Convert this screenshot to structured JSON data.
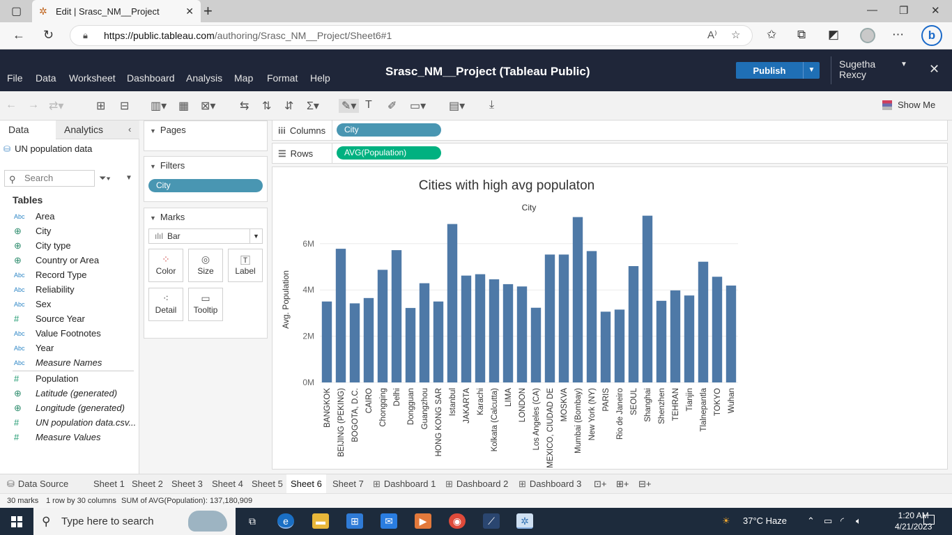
{
  "browser": {
    "tab_title": "Edit | Srasc_NM__Project",
    "url_domain": "https://public.tableau.com",
    "url_path": "/authoring/Srasc_NM__Project/Sheet6#1"
  },
  "header": {
    "menu": [
      "File",
      "Data",
      "Worksheet",
      "Dashboard",
      "Analysis",
      "Map",
      "Format",
      "Help"
    ],
    "title": "Srasc_NM__Project (Tableau Public)",
    "publish_label": "Publish",
    "user_first": "Sugetha",
    "user_last": "Rexcy"
  },
  "toolbar": {
    "show_me_label": "Show Me"
  },
  "datapane": {
    "tab_data": "Data",
    "tab_analytics": "Analytics",
    "datasource": "UN population data",
    "search_placeholder": "Search",
    "tables_label": "Tables",
    "dimensions": [
      {
        "type": "Abc",
        "label": "Area"
      },
      {
        "type": "geo",
        "label": "City"
      },
      {
        "type": "geo",
        "label": "City type"
      },
      {
        "type": "geo",
        "label": "Country or Area"
      },
      {
        "type": "Abc",
        "label": "Record Type"
      },
      {
        "type": "Abc",
        "label": "Reliability"
      },
      {
        "type": "Abc",
        "label": "Sex"
      },
      {
        "type": "#",
        "label": "Source Year"
      },
      {
        "type": "Abc",
        "label": "Value Footnotes"
      },
      {
        "type": "Abc",
        "label": "Year"
      },
      {
        "type": "Abc",
        "label": "Measure Names",
        "italic": true
      }
    ],
    "measures": [
      {
        "type": "#",
        "label": "Population"
      },
      {
        "type": "geo",
        "label": "Latitude (generated)",
        "italic": true
      },
      {
        "type": "geo",
        "label": "Longitude (generated)",
        "italic": true
      },
      {
        "type": "#",
        "label": "UN population data.csv...",
        "italic": true
      },
      {
        "type": "#",
        "label": "Measure Values",
        "italic": true
      }
    ]
  },
  "cards": {
    "pages_label": "Pages",
    "filters_label": "Filters",
    "filter_pill": "City",
    "marks_label": "Marks",
    "mark_type": "Bar",
    "mark_buttons": [
      "Color",
      "Size",
      "Label",
      "Detail",
      "Tooltip"
    ]
  },
  "shelves": {
    "columns_label": "Columns",
    "columns_pill": "City",
    "rows_label": "Rows",
    "rows_pill": "AVG(Population)"
  },
  "chart_data": {
    "type": "bar",
    "title": "Cities with high avg populaton",
    "xlabel": "City",
    "ylabel": "Avg. Population",
    "yticks": [
      "0M",
      "2M",
      "4M",
      "6M"
    ],
    "ylim": [
      0,
      7500000
    ],
    "bar_color": "#4e79a7",
    "categories": [
      "BANGKOK",
      "BEIJING (PEKING)",
      "BOGOTA, D.C.",
      "CAIRO",
      "Chongqing",
      "Delhi",
      "Dongguan",
      "Guangzhou",
      "HONG KONG SAR",
      "Istanbul",
      "JAKARTA",
      "Karachi",
      "Kolkata (Calcutta)",
      "LIMA",
      "LONDON",
      "Los Angeles (CA)",
      "MEXICO, CIUDAD DE",
      "MOSKVA",
      "Mumbai (Bombay)",
      "New York (NY)",
      "PARIS",
      "Rio de Janeiro",
      "SEOUL",
      "Shanghai",
      "Shenzhen",
      "TEHRAN",
      "Tianjin",
      "Tlalnepantla",
      "TOKYO",
      "Wuhan"
    ],
    "values": [
      3500000,
      5780000,
      3420000,
      3650000,
      4870000,
      5720000,
      3220000,
      4290000,
      3500000,
      6850000,
      4620000,
      4680000,
      4460000,
      4250000,
      4150000,
      3230000,
      5530000,
      5530000,
      7150000,
      5680000,
      3060000,
      3150000,
      5030000,
      7210000,
      3530000,
      3980000,
      3760000,
      5220000,
      4570000,
      4190000
    ]
  },
  "sheets": {
    "datasource_tab": "Data Source",
    "tabs": [
      "Sheet 1",
      "Sheet 2",
      "Sheet 3",
      "Sheet 4",
      "Sheet 5",
      "Sheet 6",
      "Sheet 7"
    ],
    "dash_tabs": [
      "Dashboard 1",
      "Dashboard 2",
      "Dashboard 3"
    ]
  },
  "status": {
    "marks": "30 marks",
    "rows_cols": "1 row by 30 columns",
    "sum": "SUM of AVG(Population): 137,180,909"
  },
  "taskbar": {
    "search_placeholder": "Type here to search",
    "weather": "37°C  Haze",
    "time": "1:20 AM",
    "date": "4/21/2023"
  }
}
